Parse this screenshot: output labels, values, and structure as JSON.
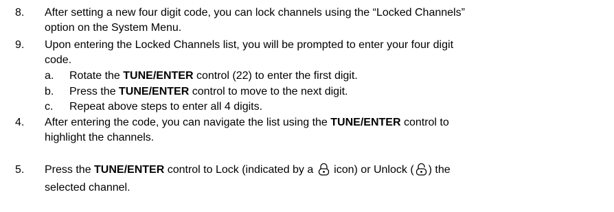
{
  "items": [
    {
      "number": "8.",
      "text_1": "After setting a new four digit code, you can lock channels using the “Locked Channels”",
      "text_2": "option on the System Menu."
    },
    {
      "number": "9.",
      "text_1": "Upon entering the Locked Channels list, you will be prompted to enter your four digit",
      "text_2": "code.",
      "subitems": [
        {
          "letter": "a.",
          "pre": "Rotate the ",
          "bold": "TUNE/ENTER",
          "post": " control (22) to enter the first digit."
        },
        {
          "letter": "b.",
          "pre": "Press the ",
          "bold": "TUNE/ENTER",
          "post": " control to move to the next digit."
        },
        {
          "letter": "c.",
          "text": "Repeat above steps to enter all 4 digits."
        }
      ]
    },
    {
      "number": "4.",
      "pre": "After entering the code, you can navigate the list using the ",
      "bold": "TUNE/ENTER",
      "post": " control to",
      "text_2": "highlight the channels."
    },
    {
      "number": "5.",
      "pre": "Press the ",
      "bold": "TUNE/ENTER",
      "mid_1": " control to Lock (indicated by a ",
      "mid_2": " icon) or Unlock (",
      "mid_3": ") the",
      "text_2": "selected channel.",
      "icons": [
        "lock-icon",
        "unlock-icon"
      ]
    }
  ]
}
